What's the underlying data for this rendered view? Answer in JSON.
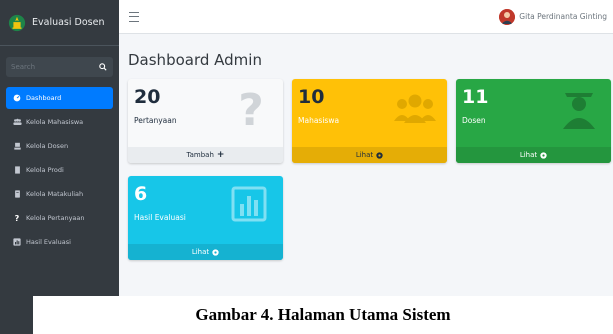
{
  "app": {
    "brand_name": "Evaluasi Dosen",
    "logo_icon": "university-logo-icon"
  },
  "search": {
    "placeholder": "Search",
    "icon": "search-icon"
  },
  "sidebar": {
    "items": [
      {
        "label": "Dashboard",
        "icon": "dashboard-icon",
        "active": true
      },
      {
        "label": "Kelola Mahasiswa",
        "icon": "users-icon",
        "active": false
      },
      {
        "label": "Kelola Dosen",
        "icon": "teacher-icon",
        "active": false
      },
      {
        "label": "Kelola Prodi",
        "icon": "building-icon",
        "active": false
      },
      {
        "label": "Kelola Matakuliah",
        "icon": "book-icon",
        "active": false
      },
      {
        "label": "Kelola Pertanyaan",
        "icon": "question-icon",
        "active": false
      },
      {
        "label": "Hasil Evaluasi",
        "icon": "report-icon",
        "active": false
      }
    ]
  },
  "navbar": {
    "menu_icon": "hamburger-menu-icon",
    "user_name": "Gita Perdinanta Ginting"
  },
  "main": {
    "title": "Dashboard Admin",
    "boxes": [
      {
        "value": "20",
        "label": "Pertanyaan",
        "footer": "Tambah",
        "footer_icon": "plus-icon",
        "icon": "question-mark-icon",
        "color": "#f8f9fa"
      },
      {
        "value": "10",
        "label": "Mahasiswa",
        "footer": "Lihat",
        "footer_icon": "eye-icon",
        "icon": "users-icon",
        "color": "#ffc107"
      },
      {
        "value": "11",
        "label": "Dosen",
        "footer": "Lihat",
        "footer_icon": "eye-icon",
        "icon": "teacher-icon",
        "color": "#28a745"
      },
      {
        "value": "6",
        "label": "Hasil Evaluasi",
        "footer": "Lihat",
        "footer_icon": "eye-icon",
        "icon": "bar-chart-icon",
        "color": "#17c6e8"
      }
    ]
  },
  "caption": "Gambar 4. Halaman Utama Sistem",
  "colors": {
    "sidebar": "#343a40",
    "active": "#007bff",
    "content_bg": "#f4f6f9"
  }
}
